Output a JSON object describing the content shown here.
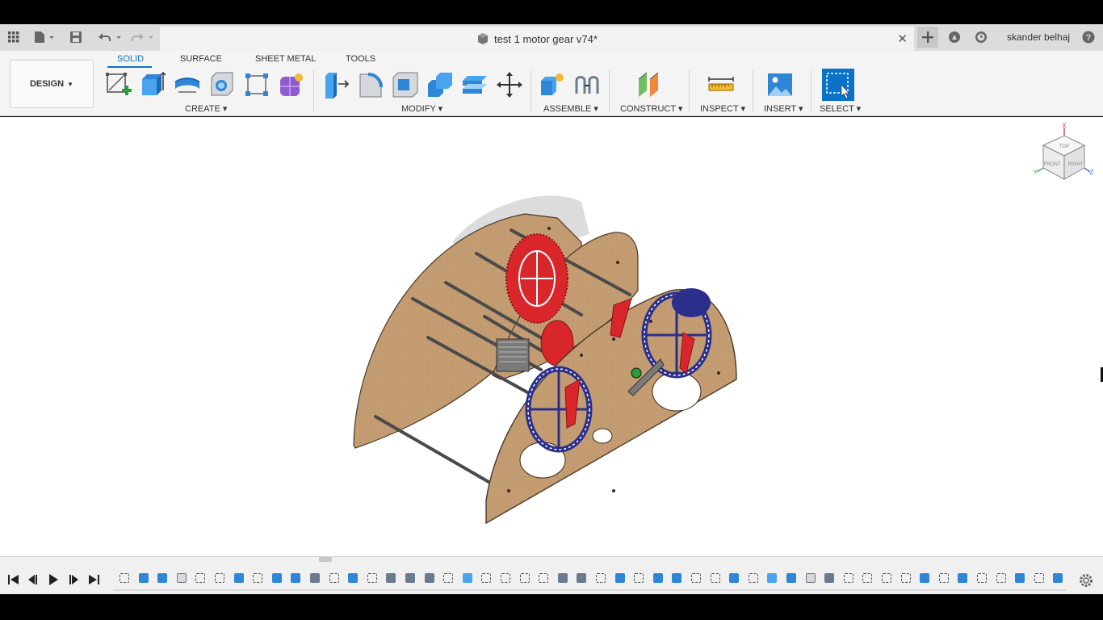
{
  "app": {
    "document_title": "test 1 motor gear v74*",
    "user_name": "skander belhaj"
  },
  "toolbar": {
    "design_label": "DESIGN"
  },
  "ribbon": {
    "tabs": [
      {
        "label": "SOLID",
        "active": true
      },
      {
        "label": "SURFACE",
        "active": false
      },
      {
        "label": "SHEET METAL",
        "active": false
      },
      {
        "label": "TOOLS",
        "active": false
      }
    ],
    "groups": [
      {
        "label": "CREATE"
      },
      {
        "label": "MODIFY"
      },
      {
        "label": "ASSEMBLE"
      },
      {
        "label": "CONSTRUCT"
      },
      {
        "label": "INSPECT"
      },
      {
        "label": "INSERT"
      },
      {
        "label": "SELECT"
      }
    ],
    "create_tools": [
      "create-sketch-icon",
      "extrude-icon",
      "revolve-icon",
      "hole-icon",
      "pattern-icon",
      "create-form-icon"
    ],
    "modify_tools": [
      "press-pull-icon",
      "fillet-icon",
      "shell-icon",
      "combine-icon",
      "offset-plane-icon",
      "move-icon"
    ],
    "assemble_tools": [
      "new-component-icon",
      "joint-icon"
    ],
    "construct_tools": [
      "offset-plane-icon"
    ],
    "inspect_tools": [
      "measure-icon"
    ],
    "insert_tools": [
      "insert-image-icon"
    ],
    "select_tools": [
      "select-icon"
    ]
  },
  "viewcube": {
    "faces": [
      "FRONT",
      "RIGHT",
      "TOP"
    ],
    "axes": [
      "X",
      "Y",
      "Z"
    ]
  },
  "timeline": {
    "controls": [
      "go-to-start",
      "step-back",
      "play",
      "step-forward",
      "go-to-end"
    ],
    "item_count": 50
  },
  "colors": {
    "accent": "#0a73c9",
    "wood": "#c49c72",
    "gear_red": "#d9262b",
    "gear_blue": "#2a2f8c",
    "rod": "#4a4a4a"
  }
}
